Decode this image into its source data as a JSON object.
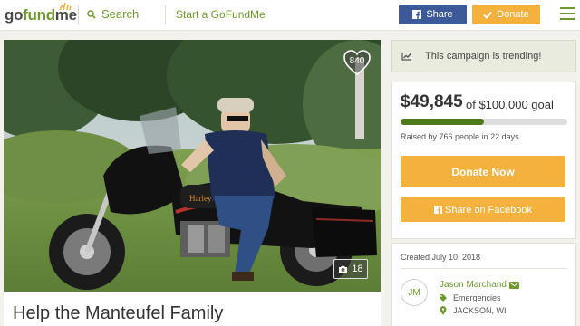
{
  "header": {
    "logo": {
      "go": "go",
      "fund": "fund",
      "me": "me"
    },
    "search_label": "Search",
    "start_label": "Start a GoFundMe",
    "share_label": "Share",
    "donate_label": "Donate"
  },
  "campaign": {
    "title": "Help the Manteufel Family",
    "hearts": "840",
    "photos": "18",
    "trending": "This campaign is trending!",
    "raised": "$49,845",
    "goal_text": "of $100,000 goal",
    "progress": 0.4985,
    "stats": "Raised by 766 people in 22 days",
    "donate_now_label": "Donate Now",
    "facebook_label": "Share on Facebook",
    "created": "Created July 10, 2018"
  },
  "organizer": {
    "initials": "JM",
    "name": "Jason Marchand",
    "category": "Emergencies",
    "location": "JACKSON, WI"
  },
  "colors": {
    "brand_green": "#6e9a2d",
    "facebook_blue": "#3c5a99",
    "donate_orange": "#f4b13e",
    "progress_green": "#4f7a1c"
  }
}
